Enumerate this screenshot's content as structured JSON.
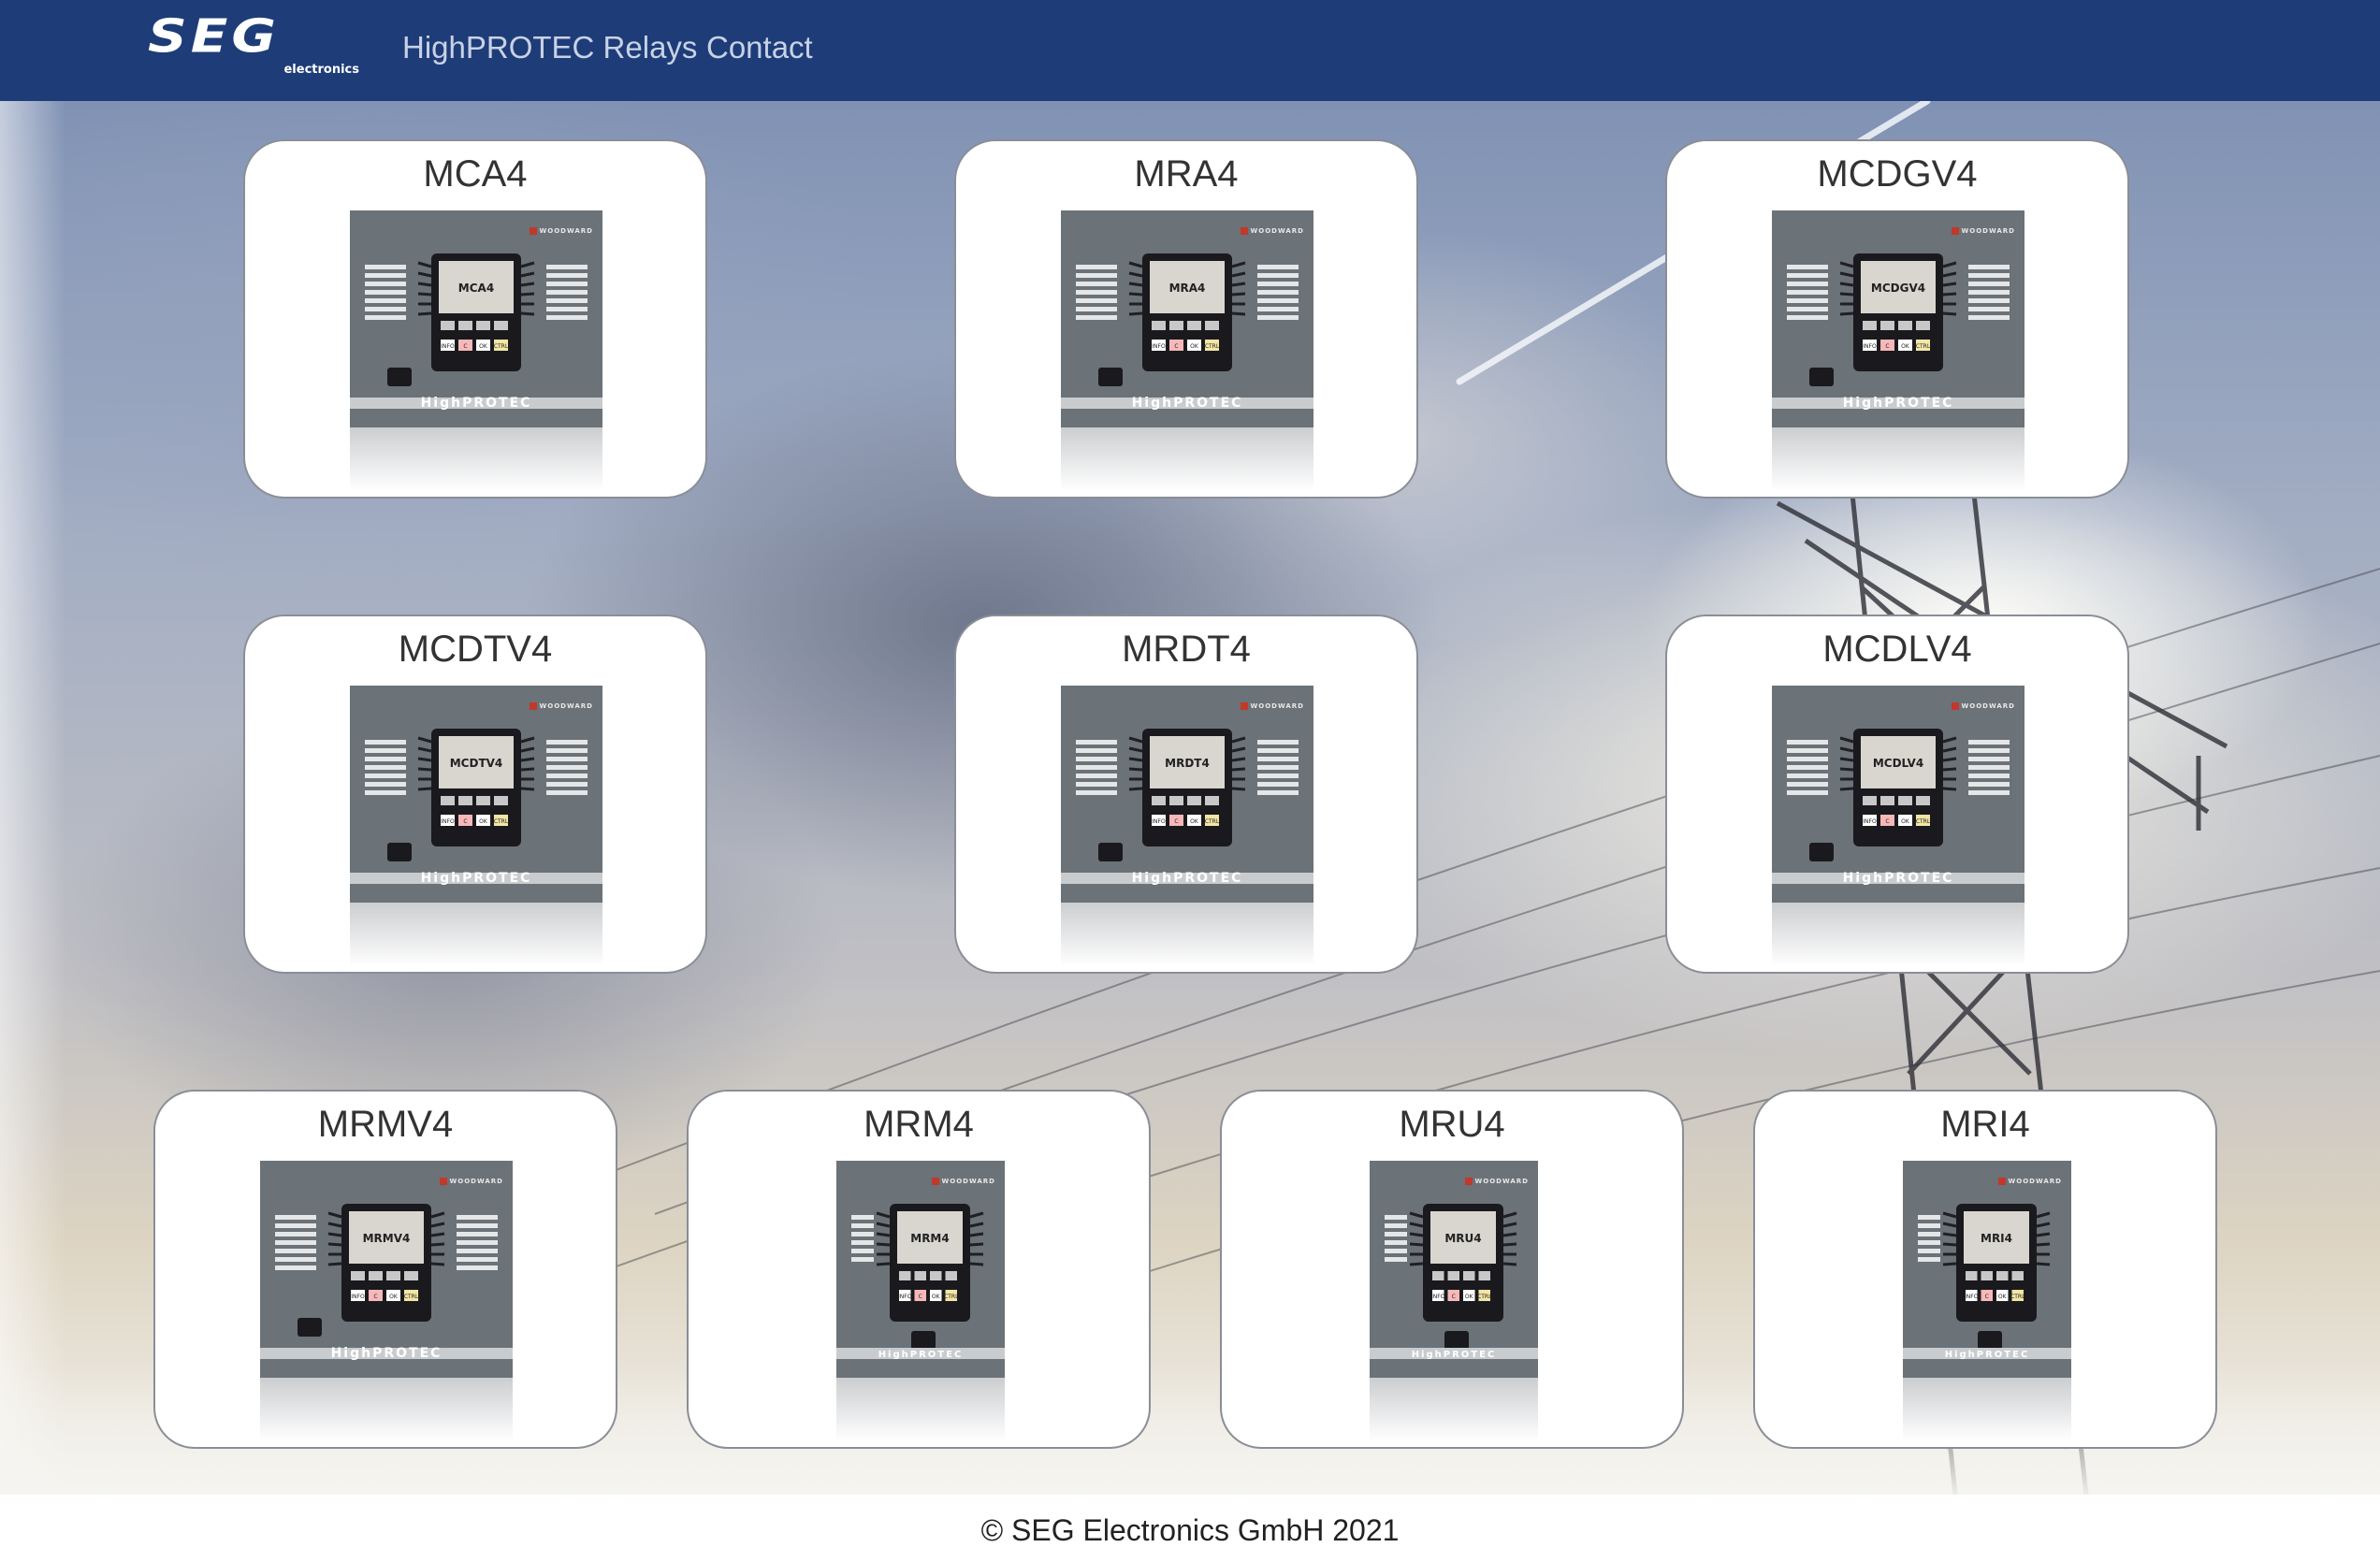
{
  "header": {
    "logo_word": "SEG",
    "logo_sub": "electronics",
    "nav": [
      {
        "label": "HighPROTEC Relays"
      },
      {
        "label": "Contact"
      }
    ]
  },
  "relays": [
    {
      "name": "MCA4",
      "screen_label": "MCA4",
      "variant": "wide",
      "brand": "WOODWARD",
      "series_label": "HighPROTEC"
    },
    {
      "name": "MRA4",
      "screen_label": "MRA4",
      "variant": "wide",
      "brand": "WOODWARD",
      "series_label": "HighPROTEC"
    },
    {
      "name": "MCDGV4",
      "screen_label": "MCDGV4",
      "variant": "wide",
      "brand": "WOODWARD",
      "series_label": "HighPROTEC"
    },
    {
      "name": "MCDTV4",
      "screen_label": "MCDTV4",
      "variant": "wide",
      "brand": "WOODWARD",
      "series_label": "HighPROTEC"
    },
    {
      "name": "MRDT4",
      "screen_label": "MRDT4",
      "variant": "wide",
      "brand": "WOODWARD",
      "series_label": "HighPROTEC"
    },
    {
      "name": "MCDLV4",
      "screen_label": "MCDLV4",
      "variant": "wide",
      "brand": "WOODWARD",
      "series_label": "HighPROTEC"
    },
    {
      "name": "MRMV4",
      "screen_label": "MRMV4",
      "variant": "wide",
      "brand": "WOODWARD",
      "series_label": "HighPROTEC"
    },
    {
      "name": "MRM4",
      "screen_label": "MRM4",
      "variant": "narrow",
      "brand": "WOODWARD",
      "series_label": "HighPROTEC"
    },
    {
      "name": "MRU4",
      "screen_label": "MRU4",
      "variant": "narrow",
      "brand": "WOODWARD",
      "series_label": "HighPROTEC"
    },
    {
      "name": "MRI4",
      "screen_label": "MRI4",
      "variant": "narrow",
      "brand": "WOODWARD",
      "series_label": "HighPROTEC"
    }
  ],
  "keypad_keys": [
    "INFO",
    "C",
    "OK",
    "CTRL"
  ],
  "footer": {
    "text": "© SEG Electronics GmbH 2021"
  },
  "colors": {
    "navbar": "#1e3c78",
    "device_body": "#6b7278",
    "card_border": "#8a8e96"
  }
}
